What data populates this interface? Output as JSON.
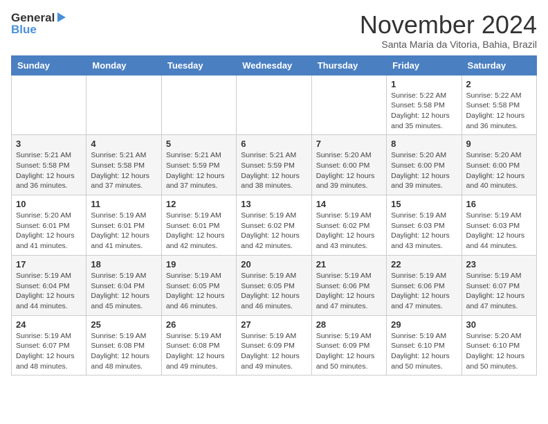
{
  "logo": {
    "line1": "General",
    "line2": "Blue"
  },
  "title": "November 2024",
  "subtitle": "Santa Maria da Vitoria, Bahia, Brazil",
  "weekdays": [
    "Sunday",
    "Monday",
    "Tuesday",
    "Wednesday",
    "Thursday",
    "Friday",
    "Saturday"
  ],
  "weeks": [
    [
      {
        "day": "",
        "info": ""
      },
      {
        "day": "",
        "info": ""
      },
      {
        "day": "",
        "info": ""
      },
      {
        "day": "",
        "info": ""
      },
      {
        "day": "",
        "info": ""
      },
      {
        "day": "1",
        "info": "Sunrise: 5:22 AM\nSunset: 5:58 PM\nDaylight: 12 hours\nand 35 minutes."
      },
      {
        "day": "2",
        "info": "Sunrise: 5:22 AM\nSunset: 5:58 PM\nDaylight: 12 hours\nand 36 minutes."
      }
    ],
    [
      {
        "day": "3",
        "info": "Sunrise: 5:21 AM\nSunset: 5:58 PM\nDaylight: 12 hours\nand 36 minutes."
      },
      {
        "day": "4",
        "info": "Sunrise: 5:21 AM\nSunset: 5:58 PM\nDaylight: 12 hours\nand 37 minutes."
      },
      {
        "day": "5",
        "info": "Sunrise: 5:21 AM\nSunset: 5:59 PM\nDaylight: 12 hours\nand 37 minutes."
      },
      {
        "day": "6",
        "info": "Sunrise: 5:21 AM\nSunset: 5:59 PM\nDaylight: 12 hours\nand 38 minutes."
      },
      {
        "day": "7",
        "info": "Sunrise: 5:20 AM\nSunset: 6:00 PM\nDaylight: 12 hours\nand 39 minutes."
      },
      {
        "day": "8",
        "info": "Sunrise: 5:20 AM\nSunset: 6:00 PM\nDaylight: 12 hours\nand 39 minutes."
      },
      {
        "day": "9",
        "info": "Sunrise: 5:20 AM\nSunset: 6:00 PM\nDaylight: 12 hours\nand 40 minutes."
      }
    ],
    [
      {
        "day": "10",
        "info": "Sunrise: 5:20 AM\nSunset: 6:01 PM\nDaylight: 12 hours\nand 41 minutes."
      },
      {
        "day": "11",
        "info": "Sunrise: 5:19 AM\nSunset: 6:01 PM\nDaylight: 12 hours\nand 41 minutes."
      },
      {
        "day": "12",
        "info": "Sunrise: 5:19 AM\nSunset: 6:01 PM\nDaylight: 12 hours\nand 42 minutes."
      },
      {
        "day": "13",
        "info": "Sunrise: 5:19 AM\nSunset: 6:02 PM\nDaylight: 12 hours\nand 42 minutes."
      },
      {
        "day": "14",
        "info": "Sunrise: 5:19 AM\nSunset: 6:02 PM\nDaylight: 12 hours\nand 43 minutes."
      },
      {
        "day": "15",
        "info": "Sunrise: 5:19 AM\nSunset: 6:03 PM\nDaylight: 12 hours\nand 43 minutes."
      },
      {
        "day": "16",
        "info": "Sunrise: 5:19 AM\nSunset: 6:03 PM\nDaylight: 12 hours\nand 44 minutes."
      }
    ],
    [
      {
        "day": "17",
        "info": "Sunrise: 5:19 AM\nSunset: 6:04 PM\nDaylight: 12 hours\nand 44 minutes."
      },
      {
        "day": "18",
        "info": "Sunrise: 5:19 AM\nSunset: 6:04 PM\nDaylight: 12 hours\nand 45 minutes."
      },
      {
        "day": "19",
        "info": "Sunrise: 5:19 AM\nSunset: 6:05 PM\nDaylight: 12 hours\nand 46 minutes."
      },
      {
        "day": "20",
        "info": "Sunrise: 5:19 AM\nSunset: 6:05 PM\nDaylight: 12 hours\nand 46 minutes."
      },
      {
        "day": "21",
        "info": "Sunrise: 5:19 AM\nSunset: 6:06 PM\nDaylight: 12 hours\nand 47 minutes."
      },
      {
        "day": "22",
        "info": "Sunrise: 5:19 AM\nSunset: 6:06 PM\nDaylight: 12 hours\nand 47 minutes."
      },
      {
        "day": "23",
        "info": "Sunrise: 5:19 AM\nSunset: 6:07 PM\nDaylight: 12 hours\nand 47 minutes."
      }
    ],
    [
      {
        "day": "24",
        "info": "Sunrise: 5:19 AM\nSunset: 6:07 PM\nDaylight: 12 hours\nand 48 minutes."
      },
      {
        "day": "25",
        "info": "Sunrise: 5:19 AM\nSunset: 6:08 PM\nDaylight: 12 hours\nand 48 minutes."
      },
      {
        "day": "26",
        "info": "Sunrise: 5:19 AM\nSunset: 6:08 PM\nDaylight: 12 hours\nand 49 minutes."
      },
      {
        "day": "27",
        "info": "Sunrise: 5:19 AM\nSunset: 6:09 PM\nDaylight: 12 hours\nand 49 minutes."
      },
      {
        "day": "28",
        "info": "Sunrise: 5:19 AM\nSunset: 6:09 PM\nDaylight: 12 hours\nand 50 minutes."
      },
      {
        "day": "29",
        "info": "Sunrise: 5:19 AM\nSunset: 6:10 PM\nDaylight: 12 hours\nand 50 minutes."
      },
      {
        "day": "30",
        "info": "Sunrise: 5:20 AM\nSunset: 6:10 PM\nDaylight: 12 hours\nand 50 minutes."
      }
    ]
  ]
}
